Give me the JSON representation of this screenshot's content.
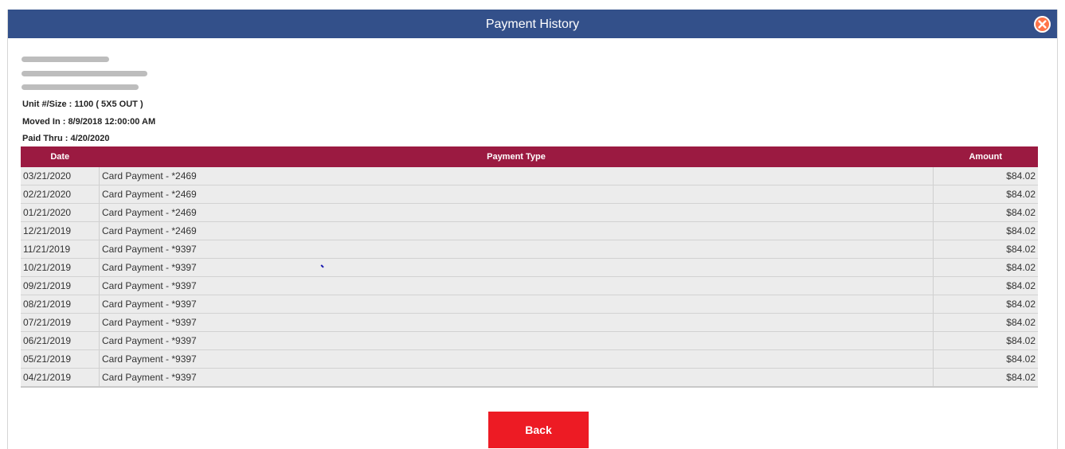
{
  "window": {
    "title": "Payment History",
    "close_icon": "close-circle-icon",
    "close_color": "#ff7448"
  },
  "customer": {
    "unit": "Unit #/Size : 1100 ( 5X5 OUT )",
    "moved_in": "Moved In : 8/9/2018 12:00:00 AM",
    "paid_thru": "Paid Thru : 4/20/2020"
  },
  "table": {
    "headers": {
      "date": "Date",
      "payment_type": "Payment Type",
      "amount": "Amount"
    },
    "rows": [
      {
        "date": "03/21/2020",
        "type": "Card Payment - *2469",
        "amount": "$84.02"
      },
      {
        "date": "02/21/2020",
        "type": "Card Payment - *2469",
        "amount": "$84.02"
      },
      {
        "date": "01/21/2020",
        "type": "Card Payment - *2469",
        "amount": "$84.02"
      },
      {
        "date": "12/21/2019",
        "type": "Card Payment - *2469",
        "amount": "$84.02"
      },
      {
        "date": "11/21/2019",
        "type": "Card Payment - *9397",
        "amount": "$84.02"
      },
      {
        "date": "10/21/2019",
        "type": "Card Payment - *9397",
        "amount": "$84.02"
      },
      {
        "date": "09/21/2019",
        "type": "Card Payment - *9397",
        "amount": "$84.02"
      },
      {
        "date": "08/21/2019",
        "type": "Card Payment - *9397",
        "amount": "$84.02"
      },
      {
        "date": "07/21/2019",
        "type": "Card Payment - *9397",
        "amount": "$84.02"
      },
      {
        "date": "06/21/2019",
        "type": "Card Payment - *9397",
        "amount": "$84.02"
      },
      {
        "date": "05/21/2019",
        "type": "Card Payment - *9397",
        "amount": "$84.02"
      },
      {
        "date": "04/21/2019",
        "type": "Card Payment - *9397",
        "amount": "$84.02"
      }
    ]
  },
  "footer": {
    "back_label": "Back"
  },
  "colors": {
    "titlebar": "#33508a",
    "table_header": "#9b1a41",
    "back_button": "#ed1b24"
  }
}
